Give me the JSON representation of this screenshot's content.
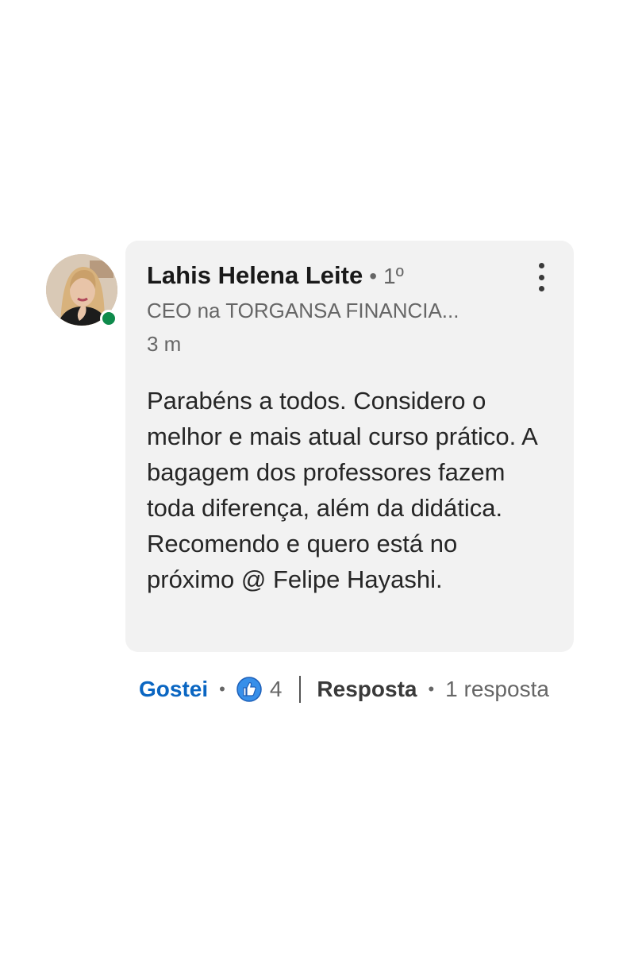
{
  "comment": {
    "author_name": "Lahis Helena Leite",
    "degree_separator": "•",
    "connection_degree": "1º",
    "headline": "CEO na TORGANSA FINANCIA...",
    "time_ago": "3 m",
    "text": "Parabéns a todos. Considero o melhor e mais atual curso prático. A bagagem dos professores fazem toda diferença, além da didática. Recomendo e quero está no próximo @ Felipe Hayashi.",
    "online_status_color": "#0e8a4b"
  },
  "actions": {
    "like_label": "Gostei",
    "separator": "•",
    "reaction_icon": "thumbs-up-icon",
    "reaction_count": "4",
    "reply_label": "Resposta",
    "reply_count_label": "1 resposta"
  },
  "colors": {
    "like_blue": "#0a66c2",
    "bubble_bg": "#f2f2f2",
    "secondary_text": "#666666"
  }
}
